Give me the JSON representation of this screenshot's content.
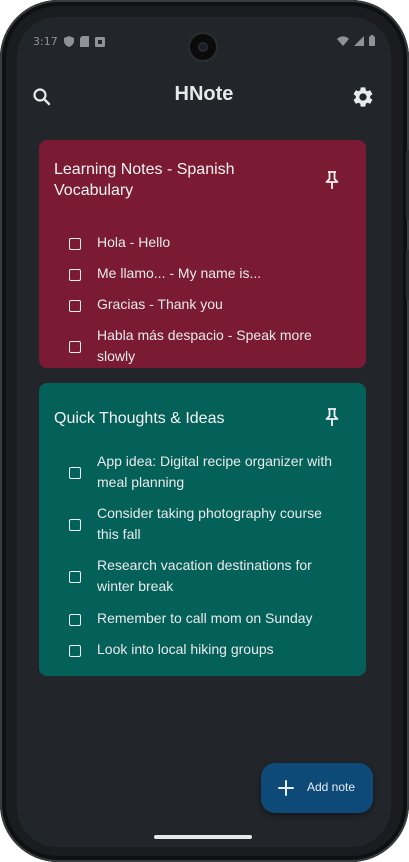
{
  "status_bar": {
    "time": "3:17"
  },
  "app_bar": {
    "title": "HNote"
  },
  "notes": [
    {
      "title": "Learning Notes - Spanish Vocabulary",
      "color": "#7a1a33",
      "pinned": true,
      "items": [
        {
          "text": "Hola - Hello",
          "checked": false
        },
        {
          "text": "Me llamo... - My name is...",
          "checked": false
        },
        {
          "text": "Gracias - Thank you",
          "checked": false
        },
        {
          "text": "Habla más despacio - Speak more slowly",
          "checked": false
        }
      ]
    },
    {
      "title": "Quick Thoughts & Ideas",
      "color": "#04615a",
      "pinned": true,
      "items": [
        {
          "text": "App idea: Digital recipe organizer with meal planning",
          "checked": false
        },
        {
          "text": "Consider taking photography course this fall",
          "checked": false
        },
        {
          "text": "Research vacation destinations for winter break",
          "checked": false
        },
        {
          "text": "Remember to call mom on Sunday",
          "checked": false
        },
        {
          "text": "Look into local hiking groups",
          "checked": false
        }
      ]
    }
  ],
  "fab": {
    "label": "Add note",
    "color": "#0e4a77"
  },
  "icons": {
    "search": "search-icon",
    "settings": "gear-icon",
    "pin": "pin-icon",
    "add": "plus-icon"
  }
}
